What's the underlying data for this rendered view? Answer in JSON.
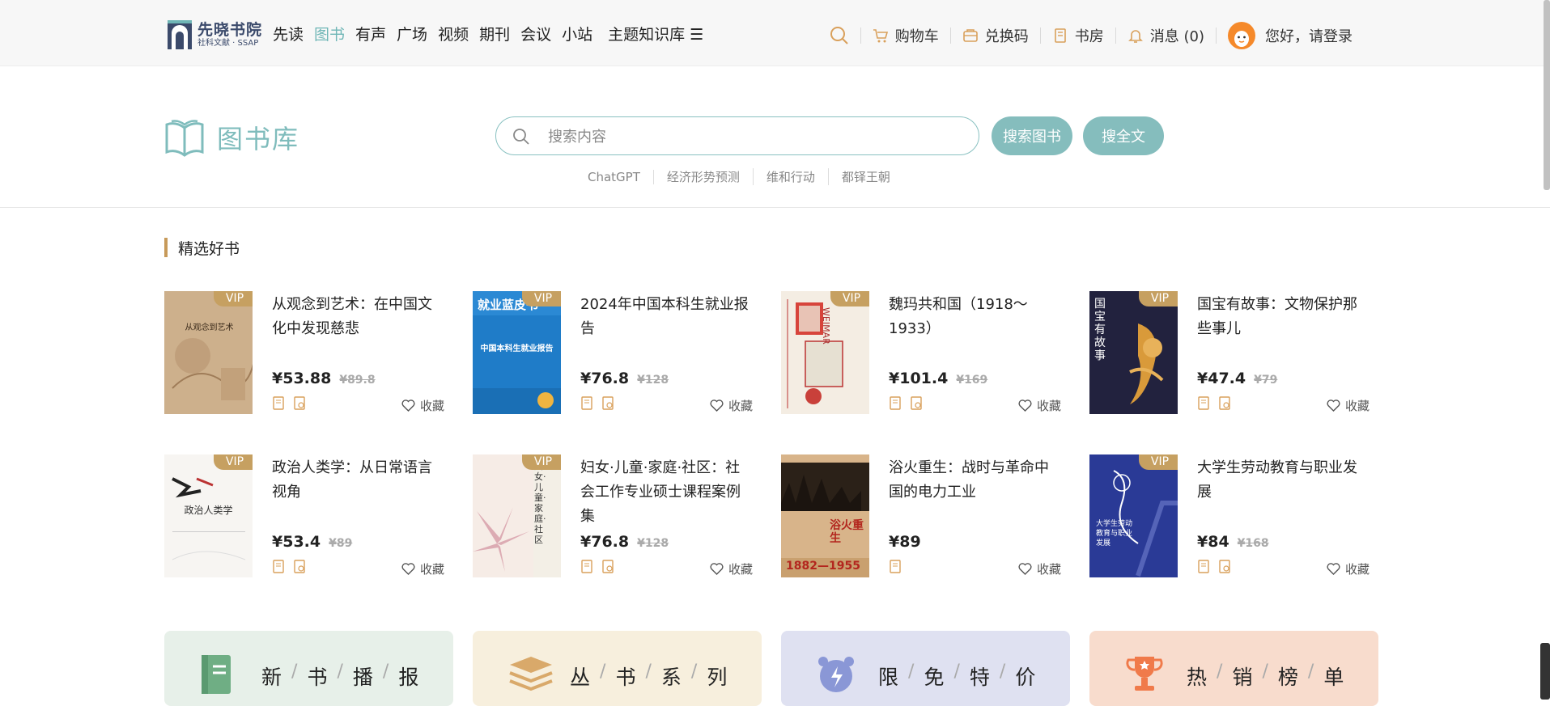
{
  "header": {
    "logo_main": "先晓书院",
    "logo_sub": "社科文献 · SSAP",
    "nav": [
      "先读",
      "图书",
      "有声",
      "广场",
      "视频",
      "期刊",
      "会议",
      "小站"
    ],
    "active_nav": "图书",
    "knowledge_base": "主题知识库 ☰",
    "cart": "购物车",
    "redeem": "兑换码",
    "study": "书房",
    "messages": "消息 (0)",
    "login": "您好，请登录"
  },
  "hero": {
    "title": "图书库",
    "search_placeholder": "搜索内容",
    "btn_search_books": "搜索图书",
    "btn_search_full": "搜全文",
    "hot_words": [
      "ChatGPT",
      "经济形势预测",
      "维和行动",
      "都铎王朝"
    ]
  },
  "section": {
    "title": "精选好书",
    "fav_label": "收藏",
    "vip_label": "VIP",
    "books": [
      {
        "title": "从观念到艺术：在中国文化中发现慈悲",
        "price": "¥53.88",
        "old_price": "¥89.8",
        "vip": true
      },
      {
        "title": "2024年中国本科生就业报告",
        "price": "¥76.8",
        "old_price": "¥128",
        "vip": true
      },
      {
        "title": "魏玛共和国（1918～1933）",
        "price": "¥101.4",
        "old_price": "¥169",
        "vip": true
      },
      {
        "title": "国宝有故事：文物保护那些事儿",
        "price": "¥47.4",
        "old_price": "¥79",
        "vip": true
      },
      {
        "title": "政治人类学：从日常语言视角",
        "price": "¥53.4",
        "old_price": "¥89",
        "vip": true
      },
      {
        "title": "妇女·儿童·家庭·社区：社会工作专业硕士课程案例集",
        "price": "¥76.8",
        "old_price": "¥128",
        "vip": true
      },
      {
        "title": "浴火重生：战时与革命中国的电力工业",
        "price": "¥89",
        "old_price": "",
        "vip": false
      },
      {
        "title": "大学生劳动教育与职业发展",
        "price": "¥84",
        "old_price": "¥168",
        "vip": true
      }
    ]
  },
  "cards": [
    {
      "chars": [
        "新",
        "书",
        "播",
        "报"
      ],
      "bg": "#e7f0e9",
      "icon": "book-icon"
    },
    {
      "chars": [
        "丛",
        "书",
        "系",
        "列"
      ],
      "bg": "#f7efdd",
      "icon": "books-stack-icon"
    },
    {
      "chars": [
        "限",
        "免",
        "特",
        "价"
      ],
      "bg": "#dfe1f1",
      "icon": "alarm-clock-icon"
    },
    {
      "chars": [
        "热",
        "销",
        "榜",
        "单"
      ],
      "bg": "#f8dccd",
      "icon": "trophy-icon"
    }
  ],
  "cover_text": {
    "b1": "从观念到艺术",
    "b2": "就业蓝皮书",
    "b2_sub": "中国本科生就业报告",
    "b3": "WEIMAR",
    "b4": "国宝有故事",
    "b5": "政治人类学",
    "b6": "妇女·儿童·家庭·社区",
    "b7": "浴火重生",
    "b7_years": "1882—1955",
    "b8": "大学生劳动教育与职业发展"
  }
}
